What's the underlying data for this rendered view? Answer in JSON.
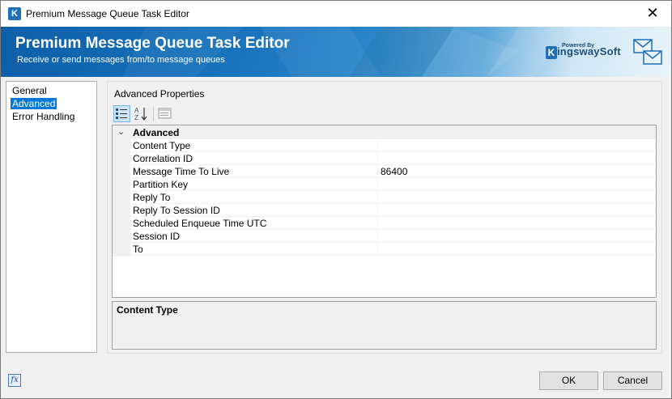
{
  "window": {
    "title": "Premium Message Queue Task Editor",
    "close_glyph": "✕",
    "app_icon_letter": "K"
  },
  "banner": {
    "title": "Premium Message Queue Task Editor",
    "subtitle": "Receive or send messages from/to message queues",
    "logo_powered": "Powered By",
    "logo_k": "K",
    "logo_name": "ingswaySoft"
  },
  "nav": {
    "items": [
      {
        "label": "General",
        "selected": false
      },
      {
        "label": "Advanced",
        "selected": true
      },
      {
        "label": "Error Handling",
        "selected": false
      }
    ]
  },
  "advanced": {
    "group_title": "Advanced Properties",
    "toolbar": {
      "categorized_icon": "categorized-view-icon",
      "alphabetical_icon": "sort-alphabetical-icon",
      "property_pages_icon": "property-pages-icon"
    },
    "category": {
      "label": "Advanced",
      "chevron": "⌄"
    },
    "properties": [
      {
        "name": "Content Type",
        "value": ""
      },
      {
        "name": "Correlation ID",
        "value": ""
      },
      {
        "name": "Message Time To Live",
        "value": "86400"
      },
      {
        "name": "Partition Key",
        "value": ""
      },
      {
        "name": "Reply To",
        "value": ""
      },
      {
        "name": "Reply To Session ID",
        "value": ""
      },
      {
        "name": "Scheduled Enqueue Time UTC",
        "value": ""
      },
      {
        "name": "Session ID",
        "value": ""
      },
      {
        "name": "To",
        "value": ""
      }
    ],
    "description": {
      "title": "Content Type",
      "text": ""
    }
  },
  "footer": {
    "expression_icon_label": "fx",
    "ok_label": "OK",
    "cancel_label": "Cancel"
  },
  "colors": {
    "accent": "#0078d7",
    "banner_blue": "#1873bd"
  }
}
